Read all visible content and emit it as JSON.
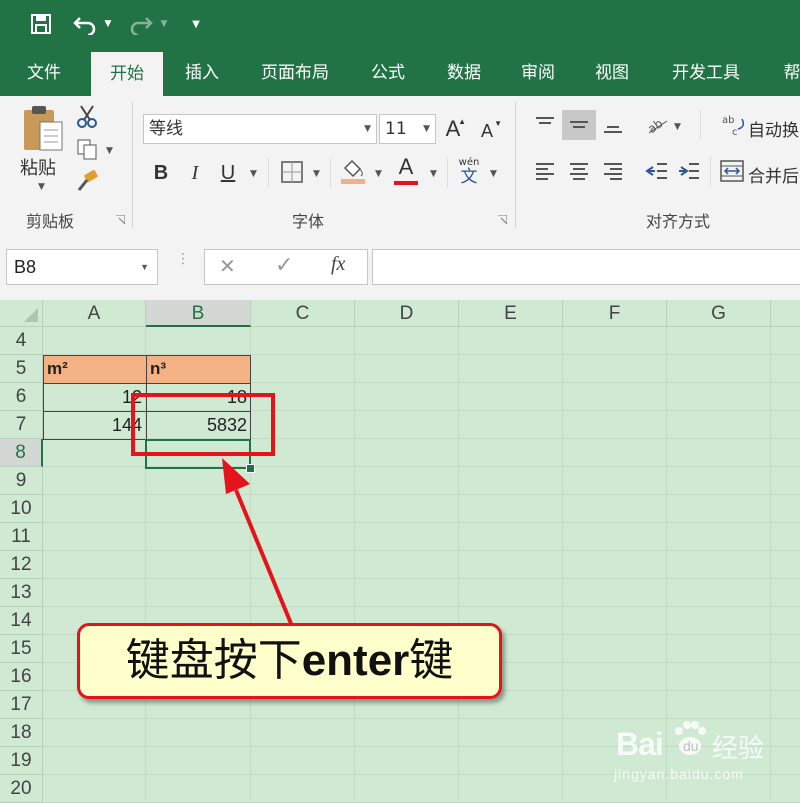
{
  "quick_access": {
    "save_icon": "save-icon",
    "undo_icon": "undo-icon",
    "redo_icon": "redo-icon",
    "customize_icon": "customize-icon"
  },
  "tabs": [
    "文件",
    "开始",
    "插入",
    "页面布局",
    "公式",
    "数据",
    "审阅",
    "视图",
    "开发工具",
    "帮"
  ],
  "active_tab": "开始",
  "ribbon": {
    "clipboard": {
      "paste_label": "粘贴",
      "group_label": "剪贴板"
    },
    "font": {
      "font_name": "等线",
      "font_size": "11",
      "grow_label": "A",
      "shrink_label": "A",
      "bold": "B",
      "italic": "I",
      "underline": "U",
      "font_color_letter": "A",
      "pinyin_top": "wén",
      "pinyin_bottom": "文",
      "group_label": "字体"
    },
    "alignment": {
      "wrap_text": "自动换",
      "merge_center": "合并后",
      "group_label": "对齐方式"
    }
  },
  "formula_bar": {
    "name_box": "B8",
    "cancel_symbol": "✕",
    "enter_symbol": "✓",
    "fx_label": "fx",
    "formula": ""
  },
  "sheet": {
    "columns": [
      "A",
      "B",
      "C",
      "D",
      "E",
      "F",
      "G"
    ],
    "selected_column": "B",
    "rows": [
      "4",
      "5",
      "6",
      "7",
      "8",
      "9",
      "10",
      "11",
      "12",
      "13",
      "14",
      "15",
      "16",
      "17",
      "18",
      "19",
      "20"
    ],
    "selected_row": "8",
    "cells": {
      "A5": "m²",
      "B5": "n³",
      "A6": "12",
      "B6": "18",
      "A7": "144",
      "B7": "5832"
    }
  },
  "annotation": {
    "callout_text_cn1": "键盘按下",
    "callout_text_en": "enter",
    "callout_text_cn2": "键"
  },
  "watermark": {
    "brand": "Bai",
    "brand_cn": "经验",
    "url": "jingyan.baidu.com"
  },
  "colors": {
    "excel_green": "#217346",
    "header_fill": "#f4b183",
    "sheet_bg": "#cfe9d2",
    "annotation_red": "#e5141b",
    "callout_fill": "#ffffcc"
  }
}
